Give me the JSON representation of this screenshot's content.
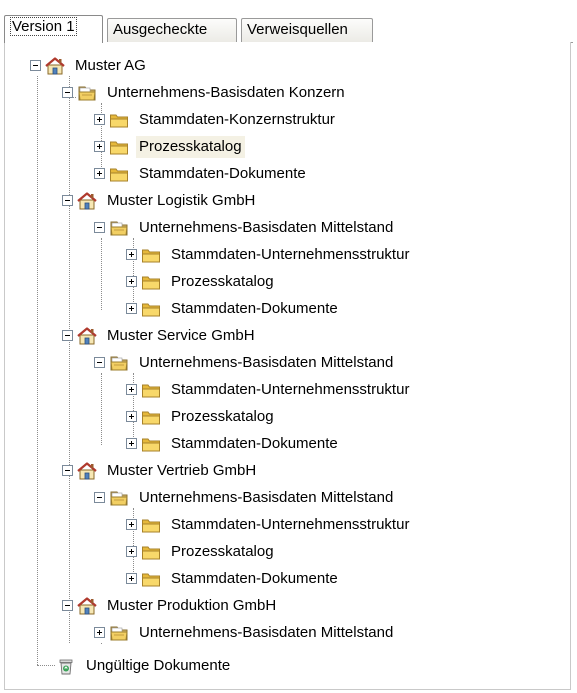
{
  "tabs": [
    "Version 1",
    "Ausgecheckte",
    "Verweisquellen"
  ],
  "tree": {
    "root": "Muster AG",
    "konzern": {
      "label": "Unternehmens-Basisdaten Konzern",
      "children": [
        "Stammdaten-Konzernstruktur",
        "Prozesskatalog",
        "Stammdaten-Dokumente"
      ]
    },
    "logistik": {
      "label": "Muster Logistik GmbH",
      "basis": "Unternehmens-Basisdaten Mittelstand",
      "children": [
        "Stammdaten-Unternehmensstruktur",
        "Prozesskatalog",
        "Stammdaten-Dokumente"
      ]
    },
    "service": {
      "label": "Muster Service GmbH",
      "basis": "Unternehmens-Basisdaten Mittelstand",
      "children": [
        "Stammdaten-Unternehmensstruktur",
        "Prozesskatalog",
        "Stammdaten-Dokumente"
      ]
    },
    "vertrieb": {
      "label": "Muster Vertrieb GmbH",
      "basis": "Unternehmens-Basisdaten Mittelstand",
      "children": [
        "Stammdaten-Unternehmensstruktur",
        "Prozesskatalog",
        "Stammdaten-Dokumente"
      ]
    },
    "produktion": {
      "label": "Muster Produktion GmbH",
      "basis": "Unternehmens-Basisdaten Mittelstand"
    },
    "invalid": "Ungültige Dokumente"
  },
  "selected": "Prozesskatalog",
  "colors": {
    "selection": "#f4f1e4",
    "folder": "#f2c744",
    "house_roof": "#c0392b"
  }
}
